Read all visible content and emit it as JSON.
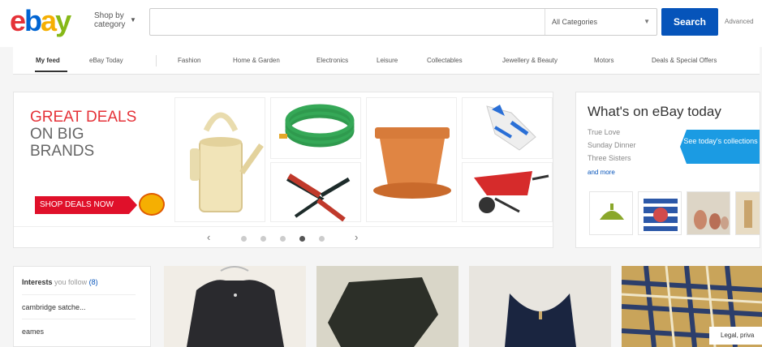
{
  "header": {
    "logo": {
      "e": "e",
      "b": "b",
      "a": "a",
      "y": "y"
    },
    "shop_by": "Shop by category",
    "search_placeholder": "",
    "category_select": "All Categories",
    "search_button": "Search",
    "advanced": "Advanced"
  },
  "nav": {
    "items": [
      "My feed",
      "eBay Today",
      "Fashion",
      "Home & Garden",
      "Electronics",
      "Leisure",
      "Collectables",
      "Jewellery & Beauty",
      "Motors",
      "Deals & Special Offers"
    ],
    "active": "My feed"
  },
  "banner": {
    "promo_line1": "GREAT DEALS",
    "promo_line2": "ON BIG",
    "promo_line3": "BRANDS",
    "shop_button": "SHOP DEALS NOW",
    "tiles": [
      "watering-can",
      "garden-hose",
      "plant-pot",
      "gardening-gloves",
      "pruning-shears",
      "wheelbarrow"
    ],
    "carousel_prev": "‹",
    "carousel_next": "›",
    "dots_total": 5,
    "active_dot": 4
  },
  "today": {
    "title": "What's on eBay today",
    "items": [
      "True Love",
      "Sunday Dinner",
      "Three Sisters"
    ],
    "more": "and more",
    "collections_button": "See today's collections",
    "thumbnails": [
      "green-lamp",
      "striped-cushion",
      "figurines",
      "vase"
    ]
  },
  "interests": {
    "title_bold": "Interests",
    "title_muted": "you follow",
    "count": "(8)",
    "rows": [
      "cambridge satche...",
      "eames"
    ]
  },
  "products": [
    "black-dress",
    "dark-knit-sweater",
    "navy-dress",
    "plaid-shirt"
  ],
  "legal": "Legal, priva",
  "colors": {
    "accent_blue": "#0654ba",
    "promo_red": "#e53238",
    "collections_blue": "#1b9be3"
  }
}
